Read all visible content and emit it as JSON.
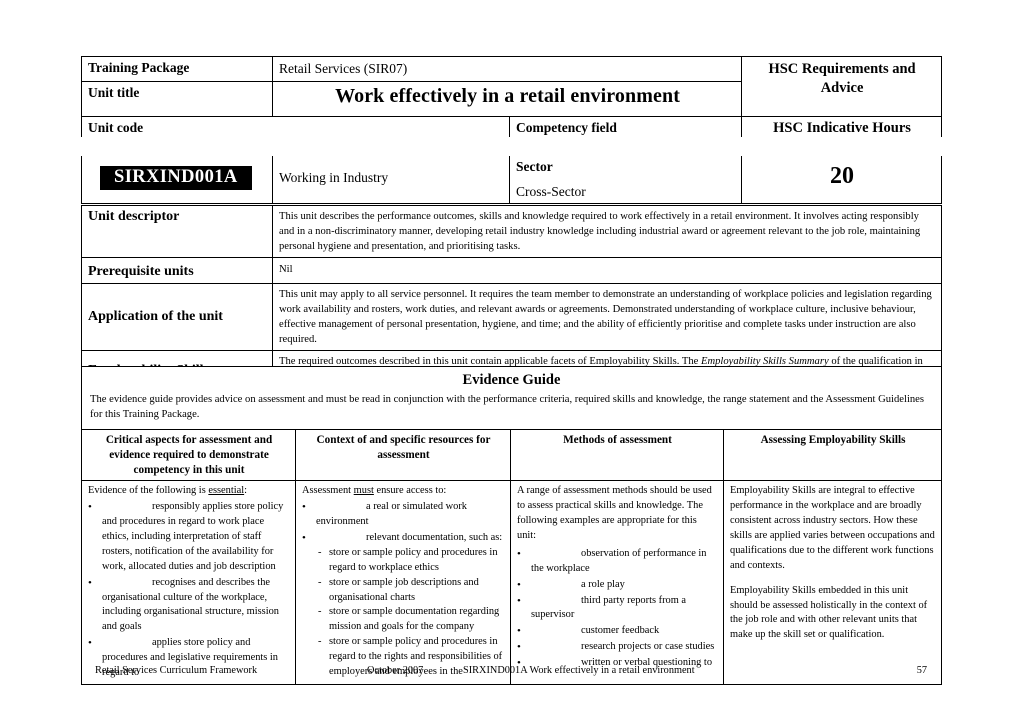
{
  "document": {
    "type": "competency-unit-record",
    "header": {
      "training_package_label": "Training Package",
      "training_package_value": "Retail Services (SIR07)",
      "unit_title_label": "Unit title",
      "unit_title_value": "Work effectively in a retail environment",
      "hsc_requirements_title": "HSC Requirements and Advice",
      "unit_code_label": "Unit code",
      "unit_code_value": "SIRXIND001A",
      "competency_field_label": "Competency field",
      "competency_field_value": "Working in Industry",
      "sector_label": "Sector",
      "sector_value": "Cross-Sector",
      "hsc_indicative_hours_label": "HSC Indicative Hours",
      "hsc_indicative_hours_value": "20"
    },
    "descriptor": {
      "unit_descriptor_label": "Unit descriptor",
      "unit_descriptor_text": "This unit describes the performance outcomes, skills and knowledge required to work effectively in a retail environment. It involves acting responsibly and in a non-discriminatory manner, developing retail industry knowledge including industrial award or agreement relevant to the job role, maintaining personal hygiene and presentation, and prioritising tasks.",
      "prerequisite_units_label": "Prerequisite units",
      "prerequisite_units_text": "Nil",
      "application_label": "Application of the unit",
      "application_text": "This unit may apply to all service personnel. It requires the team member to demonstrate an understanding of workplace policies and legislation regarding work availability and rosters, work duties, and relevant awards or agreements. Demonstrated understanding of workplace culture, inclusive behaviour, effective management of personal presentation, hygiene, and time; and the ability of efficiently prioritise and complete tasks under instruction are also required.",
      "employability_label": "Employability Skills",
      "employability_text_part1": "The required outcomes described in this unit contain applicable facets of Employability Skills. The ",
      "employability_text_italic": "Employability Skills Summary",
      "employability_text_part2": " of the qualification in which this unit is packaged will assist in identifying Employability Skill requirements."
    },
    "evidence_guide": {
      "title": "Evidence Guide",
      "intro": "The evidence guide provides advice on assessment and must be read in conjunction with the performance criteria, required skills and knowledge, the range statement and the Assessment Guidelines for this Training Package.",
      "columns": [
        "Critical aspects for assessment and evidence required to demonstrate competency in this unit",
        "Context of and specific resources for assessment",
        "Methods of assessment",
        "Assessing Employability Skills"
      ],
      "col1": {
        "intro_part1": "Evidence of the following is ",
        "intro_underline": "essential",
        "intro_part2": ":",
        "bullets": [
          "responsibly applies store policy and procedures in regard to work place ethics, including interpretation of staff rosters, notification of the availability for work, allocated duties and job description",
          "recognises and describes the organisational culture of the workplace, including organisational structure, mission and goals",
          "applies store policy and procedures and legislative requirements in regard to"
        ]
      },
      "col2": {
        "intro_part1": "Assessment ",
        "intro_underline": "must",
        "intro_part2": " ensure access to:",
        "bullet1": "a real or simulated work environment",
        "bullet2": "relevant documentation, such as:",
        "subbullets": [
          "store or sample policy and procedures in regard to workplace ethics",
          "store or sample job descriptions and organisational charts",
          "store or sample documentation regarding mission and goals for the company",
          "store or sample policy and procedures in regard to the rights and responsibilities of employers and employees in the"
        ]
      },
      "col3": {
        "intro": "A range of assessment methods should be used to assess practical skills and knowledge. The following examples are appropriate for this unit:",
        "bullets": [
          "observation of performance in the workplace",
          "a role play",
          "third party reports from a supervisor",
          "customer feedback",
          "research projects or case studies",
          "written or verbal questioning to"
        ]
      },
      "col4": {
        "para1": "Employability Skills are integral to effective performance in the workplace and are broadly consistent across industry sectors. How these skills are applied varies between occupations and qualifications due to the different work functions and contexts.",
        "para2": "Employability Skills embedded in this unit should be assessed holistically in the context of the job role and with other relevant units that make up the skill set or qualification."
      }
    },
    "footer": {
      "framework": "Retail Services Curriculum Framework",
      "date": "October 2007",
      "unit": "SIRXIND001A Work effectively in a retail environment",
      "page": "57"
    }
  }
}
